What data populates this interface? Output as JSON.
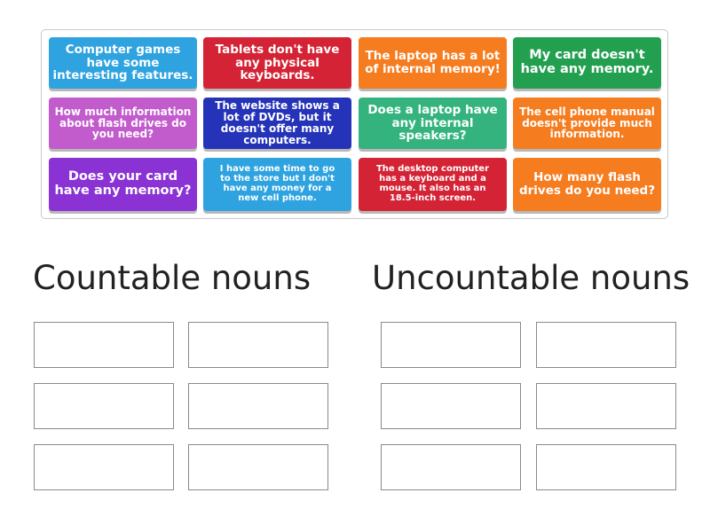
{
  "cards": [
    {
      "text": "Computer games have some interesting features.",
      "color": "#2ea3e0"
    },
    {
      "text": "Tablets don't have any physical keyboards.",
      "color": "#d42335"
    },
    {
      "text": "The laptop has a lot of internal memory!",
      "color": "#f57c1f"
    },
    {
      "text": "My card doesn't have any memory.",
      "color": "#22a050"
    },
    {
      "text": "How much information about flash drives do you need?",
      "color": "#c25ccd"
    },
    {
      "text": "The website shows a lot of DVDs, but it doesn't offer many computers.",
      "color": "#2433b8"
    },
    {
      "text": "Does a laptop have any internal speakers?",
      "color": "#34b37e"
    },
    {
      "text": "The cell phone manual doesn't provide much information.",
      "color": "#f57c1f"
    },
    {
      "text": "Does your card have any memory?",
      "color": "#8a32d4"
    },
    {
      "text": "I have some time to go to the store but I don't have any money for a new cell phone.",
      "color": "#2ea3e0"
    },
    {
      "text": "The desktop computer has a keyboard and a mouse. It also has an 18.5-inch screen.",
      "color": "#d42335"
    },
    {
      "text": "How many flash drives do you need?",
      "color": "#f57c1f"
    }
  ],
  "groups": {
    "countable": {
      "title": "Countable nouns"
    },
    "uncountable": {
      "title": "Uncountable nouns"
    }
  }
}
